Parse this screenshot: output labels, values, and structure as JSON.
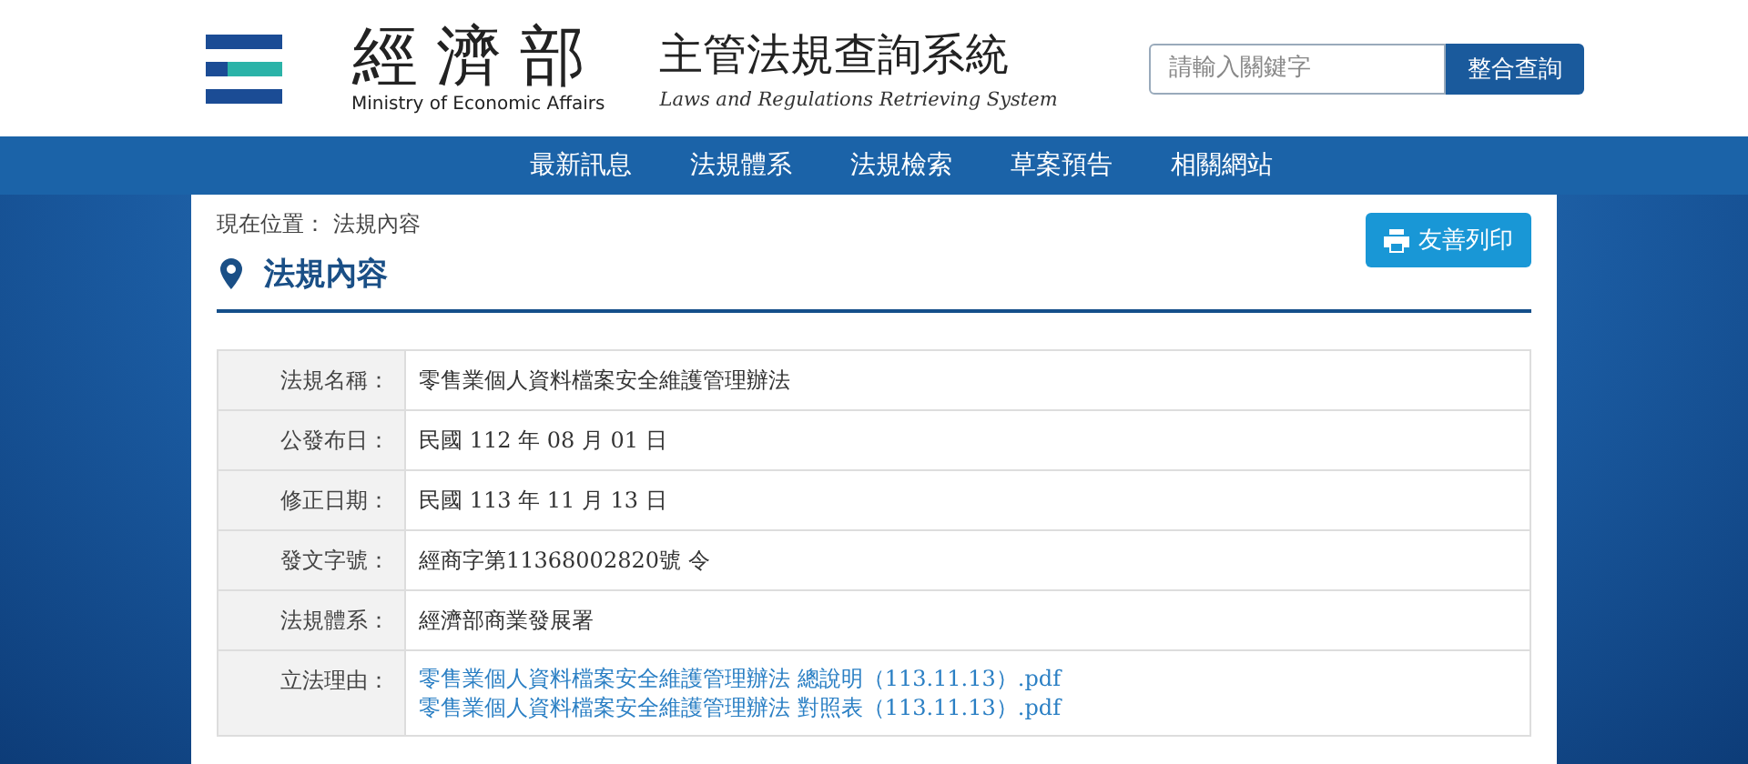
{
  "header": {
    "ministry_name": "經濟部",
    "ministry_english": "Ministry of Economic Affairs",
    "system_name": "主管法規查詢系統",
    "system_english": "Laws and Regulations Retrieving System",
    "search": {
      "placeholder": "請輸入關鍵字",
      "button": "整合查詢"
    }
  },
  "nav": [
    {
      "label": "最新訊息"
    },
    {
      "label": "法規體系"
    },
    {
      "label": "法規檢索"
    },
    {
      "label": "草案預告"
    },
    {
      "label": "相關網站"
    }
  ],
  "breadcrumb": {
    "label": "現在位置：",
    "current": "法規內容"
  },
  "print_button": "友善列印",
  "section_title": "法規內容",
  "rows": [
    {
      "kind": "text",
      "label": "法規名稱：",
      "value": "零售業個人資料檔案安全維護管理辦法"
    },
    {
      "kind": "text",
      "label": "公發布日：",
      "value": "民國 112 年 08 月 01 日"
    },
    {
      "kind": "text",
      "label": "修正日期：",
      "value": "民國 113 年 11 月 13 日"
    },
    {
      "kind": "text",
      "label": "發文字號：",
      "value": "經商字第11368002820號 令"
    },
    {
      "kind": "text",
      "label": "法規體系：",
      "value": "經濟部商業發展署"
    },
    {
      "kind": "links",
      "label": "立法理由：",
      "links": [
        "零售業個人資料檔案安全維護管理辦法 總說明（113.11.13）.pdf",
        "零售業個人資料檔案安全維護管理辦法 對照表（113.11.13）.pdf"
      ]
    }
  ]
}
